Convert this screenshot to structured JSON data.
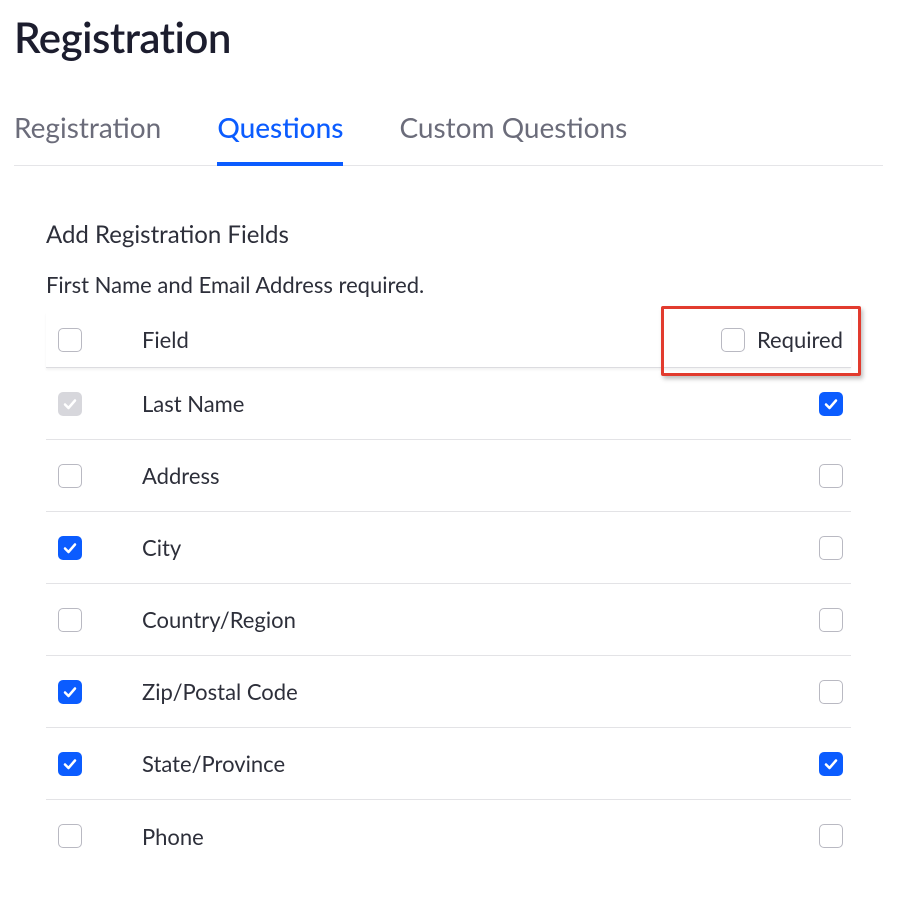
{
  "page": {
    "title": "Registration"
  },
  "tabs": [
    {
      "label": "Registration",
      "active": false
    },
    {
      "label": "Questions",
      "active": true
    },
    {
      "label": "Custom Questions",
      "active": false
    }
  ],
  "section": {
    "title": "Add Registration Fields",
    "note": "First Name and Email Address required."
  },
  "table": {
    "headers": {
      "field": "Field",
      "required": "Required"
    },
    "rows": [
      {
        "field": "Last Name",
        "enabled": true,
        "enabled_disabled": true,
        "required": true
      },
      {
        "field": "Address",
        "enabled": false,
        "enabled_disabled": false,
        "required": false
      },
      {
        "field": "City",
        "enabled": true,
        "enabled_disabled": false,
        "required": false
      },
      {
        "field": "Country/Region",
        "enabled": false,
        "enabled_disabled": false,
        "required": false
      },
      {
        "field": "Zip/Postal Code",
        "enabled": true,
        "enabled_disabled": false,
        "required": false
      },
      {
        "field": "State/Province",
        "enabled": true,
        "enabled_disabled": false,
        "required": true
      },
      {
        "field": "Phone",
        "enabled": false,
        "enabled_disabled": false,
        "required": false
      }
    ]
  }
}
